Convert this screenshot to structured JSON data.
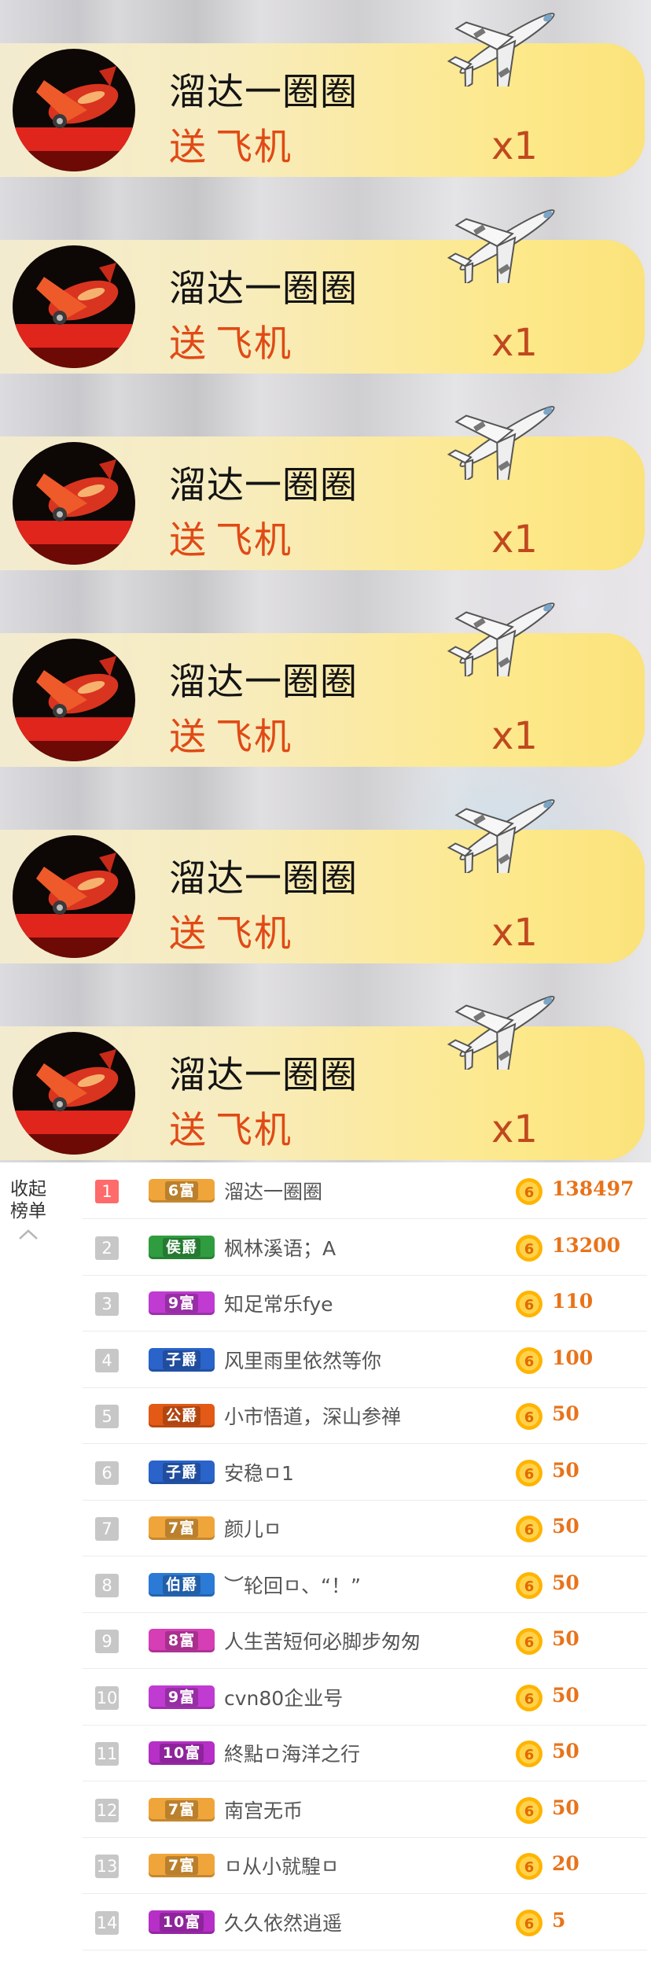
{
  "gift_feed": {
    "items": [
      {
        "sender": "溜达一圈圈",
        "action": "送",
        "gift": "飞机",
        "count": "x1"
      },
      {
        "sender": "溜达一圈圈",
        "action": "送",
        "gift": "飞机",
        "count": "x1"
      },
      {
        "sender": "溜达一圈圈",
        "action": "送",
        "gift": "飞机",
        "count": "x1"
      },
      {
        "sender": "溜达一圈圈",
        "action": "送",
        "gift": "飞机",
        "count": "x1"
      },
      {
        "sender": "溜达一圈圈",
        "action": "送",
        "gift": "飞机",
        "count": "x1"
      },
      {
        "sender": "溜达一圈圈",
        "action": "送",
        "gift": "飞机",
        "count": "x1"
      }
    ]
  },
  "ranking": {
    "collapse_label_1": "收起",
    "collapse_label_2": "榜单",
    "rows": [
      {
        "rank": "1",
        "badge": "6富",
        "badge_color": "#f0a53a",
        "name": "溜达一圈圈",
        "value": "138497"
      },
      {
        "rank": "2",
        "badge": "侯爵",
        "badge_color": "#2f9d3f",
        "name": "枫林溪语；A",
        "value": "13200"
      },
      {
        "rank": "3",
        "badge": "9富",
        "badge_color": "#c03bd2",
        "name": "知足常乐fye",
        "value": "110"
      },
      {
        "rank": "4",
        "badge": "子爵",
        "badge_color": "#2a63c9",
        "name": "风里雨里依然等你",
        "value": "100"
      },
      {
        "rank": "5",
        "badge": "公爵",
        "badge_color": "#e35a16",
        "name": "小市悟道，深山参禅",
        "value": "50"
      },
      {
        "rank": "6",
        "badge": "子爵",
        "badge_color": "#2a63c9",
        "name": "安稳ㅁ1",
        "value": "50"
      },
      {
        "rank": "7",
        "badge": "7富",
        "badge_color": "#f0a53a",
        "name": "颜儿ㅁ",
        "value": "50"
      },
      {
        "rank": "8",
        "badge": "伯爵",
        "badge_color": "#2b7ad6",
        "name": "︶轮回ㅁ、“！”",
        "value": "50"
      },
      {
        "rank": "9",
        "badge": "8富",
        "badge_color": "#d63eb5",
        "name": "人生苦短何必脚步匆匆",
        "value": "50"
      },
      {
        "rank": "10",
        "badge": "9富",
        "badge_color": "#c03bd2",
        "name": "cvn80企业号",
        "value": "50"
      },
      {
        "rank": "11",
        "badge": "10富",
        "badge_color": "#b62fc7",
        "name": "終點ㅁ海洋之行",
        "value": "50"
      },
      {
        "rank": "12",
        "badge": "7富",
        "badge_color": "#f0a53a",
        "name": "南宫无币",
        "value": "50"
      },
      {
        "rank": "13",
        "badge": "7富",
        "badge_color": "#f0a53a",
        "name": "ㅁ从小就騜ㅁ",
        "value": "20"
      },
      {
        "rank": "14",
        "badge": "10富",
        "badge_color": "#b62fc7",
        "name": "久久依然逍遥",
        "value": "5"
      }
    ]
  },
  "colors": {
    "accent_orange": "#e8731a",
    "gift_text": "#e04a15",
    "top_rank": "#ff6a6a"
  }
}
